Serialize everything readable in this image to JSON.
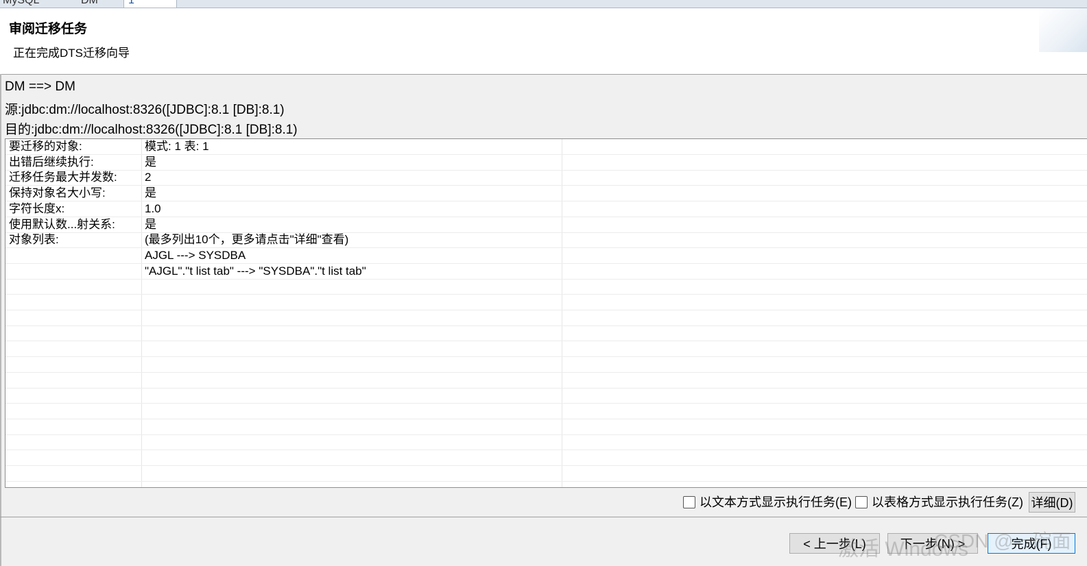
{
  "tabs": [
    "MySQL",
    "DM",
    "1"
  ],
  "header": {
    "title": "审阅迁移任务",
    "subtitle": "正在完成DTS迁移向导"
  },
  "summary": {
    "direction": "DM ==> DM",
    "source": "源:jdbc:dm://localhost:8326([JDBC]:8.1 [DB]:8.1)",
    "target": "目的:jdbc:dm://localhost:8326([JDBC]:8.1 [DB]:8.1)"
  },
  "grid": {
    "rows": [
      {
        "key": "要迁移的对象:",
        "value": "模式: 1 表: 1"
      },
      {
        "key": "出错后继续执行:",
        "value": "是"
      },
      {
        "key": "迁移任务最大并发数:",
        "value": "2"
      },
      {
        "key": "保持对象名大小写:",
        "value": "是"
      },
      {
        "key": "字符长度x:",
        "value": "1.0"
      },
      {
        "key": "使用默认数...射关系:",
        "value": "是"
      },
      {
        "key": "对象列表:",
        "value": "(最多列出10个，更多请点击\"详细\"查看)"
      },
      {
        "key": "",
        "value": "AJGL ---> SYSDBA"
      },
      {
        "key": "",
        "value": "\"AJGL\".\"t list tab\" ---> \"SYSDBA\".\"t list tab\""
      },
      {
        "key": "",
        "value": ""
      },
      {
        "key": "",
        "value": ""
      },
      {
        "key": "",
        "value": ""
      },
      {
        "key": "",
        "value": ""
      },
      {
        "key": "",
        "value": ""
      },
      {
        "key": "",
        "value": ""
      },
      {
        "key": "",
        "value": ""
      },
      {
        "key": "",
        "value": ""
      },
      {
        "key": "",
        "value": ""
      },
      {
        "key": "",
        "value": ""
      },
      {
        "key": "",
        "value": ""
      },
      {
        "key": "",
        "value": ""
      },
      {
        "key": "",
        "value": ""
      }
    ]
  },
  "options": {
    "text_mode_label": "以文本方式显示执行任务(E)",
    "text_mode_checked": false,
    "table_mode_label": "以表格方式显示执行任务(Z)",
    "table_mode_checked": false,
    "detail_label": "详细(D)"
  },
  "footer": {
    "back_label": "< 上一步(L)",
    "next_label": "下一步(N) >",
    "finish_label": "完成(F)"
  },
  "watermarks": {
    "activate": "激活 Windows",
    "csdn": "CSDN @一碗面"
  }
}
